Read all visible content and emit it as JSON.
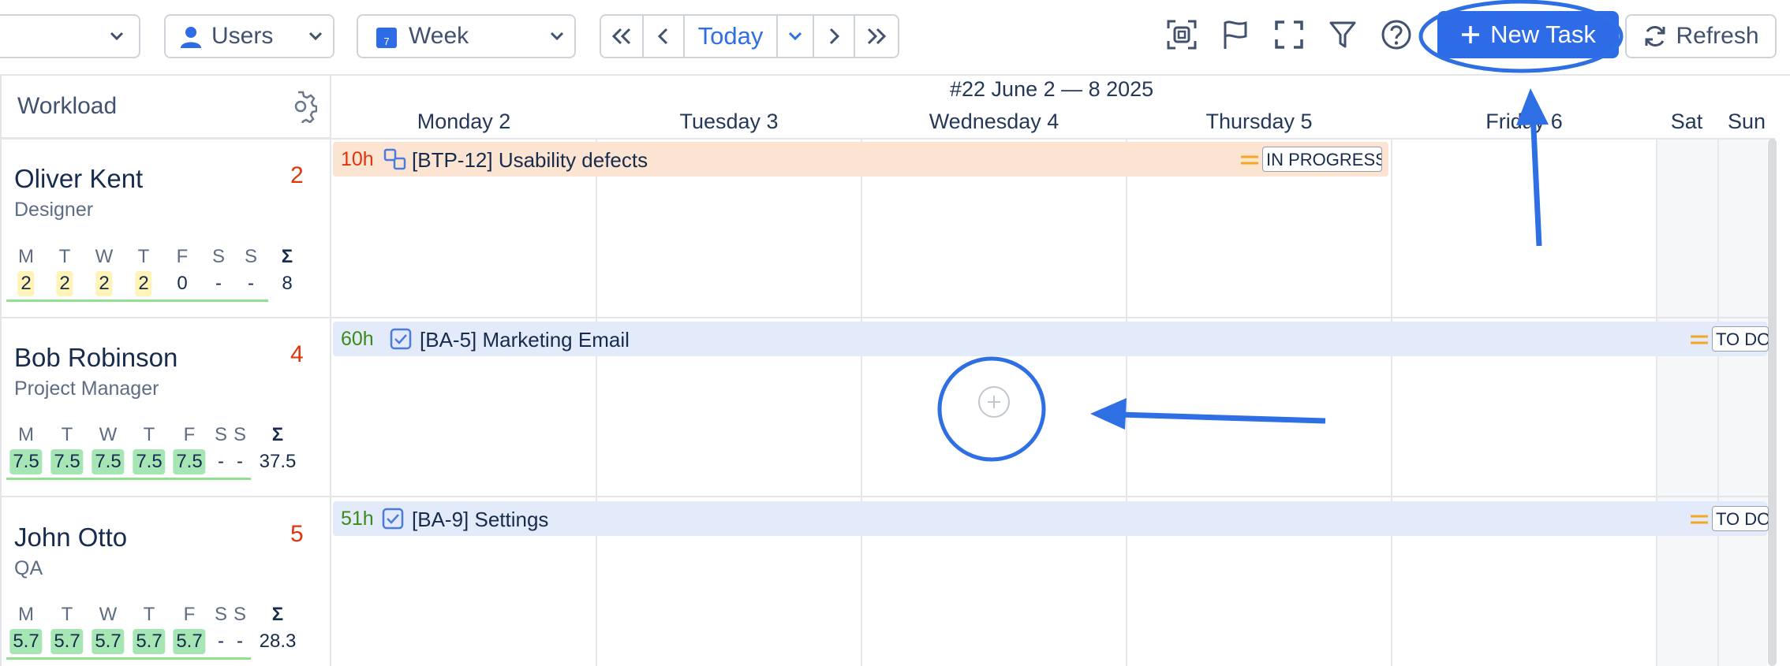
{
  "toolbar": {
    "group_select": {
      "value": "Users"
    },
    "period_select": {
      "value": "Week",
      "calendar_day": "7"
    },
    "today_label": "Today",
    "new_task_label": "New Task",
    "refresh_label": "Refresh"
  },
  "sidebar_header": {
    "title": "Workload"
  },
  "calendar": {
    "week_title": "#22 June 2 — 8 2025",
    "days": [
      "Monday 2",
      "Tuesday 3",
      "Wednesday 4",
      "Thursday 5",
      "Friday 6",
      "Sat",
      "Sun"
    ]
  },
  "users": [
    {
      "name": "Oliver Kent",
      "role": "Designer",
      "task_count": "2",
      "day_letters": [
        "M",
        "T",
        "W",
        "T",
        "F",
        "S",
        "S",
        "Σ"
      ],
      "day_values": [
        "2",
        "2",
        "2",
        "2",
        "0",
        "-",
        "-",
        "8"
      ],
      "task": {
        "hours": "10h",
        "title": "[BTP-12] Usability defects",
        "status": "IN PROGRESS",
        "icon": "subtask-icon"
      }
    },
    {
      "name": "Bob Robinson",
      "role": "Project Manager",
      "task_count": "4",
      "day_letters": [
        "M",
        "T",
        "W",
        "T",
        "F",
        "S",
        "S",
        "Σ"
      ],
      "day_values": [
        "7.5",
        "7.5",
        "7.5",
        "7.5",
        "7.5",
        "-",
        "-",
        "37.5"
      ],
      "task": {
        "hours": "60h",
        "title": "[BA-5] Marketing Email",
        "status": "TO DO",
        "icon": "checkbox-icon"
      }
    },
    {
      "name": "John Otto",
      "role": "QA",
      "task_count": "5",
      "day_letters": [
        "M",
        "T",
        "W",
        "T",
        "F",
        "S",
        "S",
        "Σ"
      ],
      "day_values": [
        "5.7",
        "5.7",
        "5.7",
        "5.7",
        "5.7",
        "-",
        "-",
        "28.3"
      ],
      "task": {
        "hours": "51h",
        "title": "[BA-9] Settings",
        "status": "TO DO",
        "icon": "checkbox-icon"
      }
    }
  ],
  "colors": {
    "accent": "#2e6be6",
    "annotation": "#2f6fe4",
    "overload": "#de350b",
    "in_progress_bar": "#fce4d2",
    "todo_bar": "#e3ebfb",
    "priority": "#f5a623"
  }
}
